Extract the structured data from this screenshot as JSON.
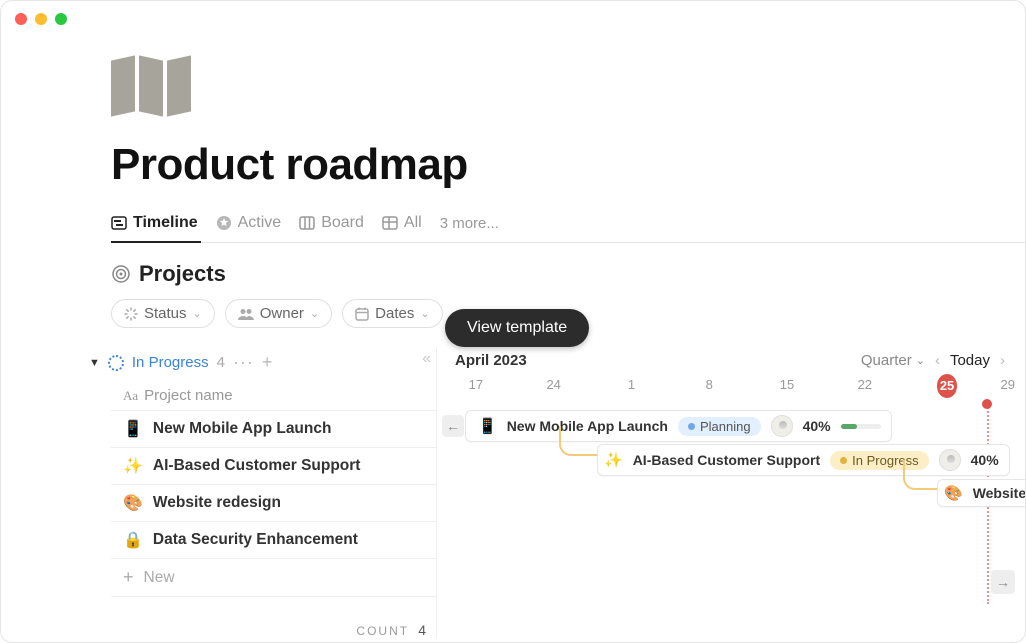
{
  "page": {
    "title": "Product roadmap"
  },
  "views": [
    {
      "label": "Timeline",
      "active": true
    },
    {
      "label": "Active",
      "active": false
    },
    {
      "label": "Board",
      "active": false
    },
    {
      "label": "All",
      "active": false
    }
  ],
  "views_more": "3 more...",
  "section": {
    "title": "Projects"
  },
  "filters": {
    "status": "Status",
    "owner": "Owner",
    "dates": "Dates"
  },
  "group": {
    "name": "In Progress",
    "count": "4",
    "column_header": "Project name"
  },
  "rows": [
    {
      "emoji": "📱",
      "name": "New Mobile App Launch"
    },
    {
      "emoji": "✨",
      "name": "AI-Based Customer Support"
    },
    {
      "emoji": "🎨",
      "name": "Website redesign"
    },
    {
      "emoji": "🔒",
      "name": "Data Security Enhancement"
    }
  ],
  "new_label": "New",
  "footer": {
    "label": "COUNT",
    "value": "4"
  },
  "timeline": {
    "month": "April 2023",
    "scale": "Quarter",
    "today": "Today",
    "dates": [
      "17",
      "24",
      "1",
      "8",
      "15",
      "22",
      "25",
      "29"
    ]
  },
  "cards": {
    "a": {
      "emoji": "📱",
      "title": "New Mobile App Launch",
      "status": "Planning",
      "pct": "40%",
      "fill": 40
    },
    "b": {
      "emoji": "✨",
      "title": "AI-Based Customer Support",
      "status": "In Progress",
      "pct": "40%",
      "fill": 40
    },
    "c": {
      "emoji": "🎨",
      "title": "Website re"
    }
  },
  "view_template": "View template"
}
